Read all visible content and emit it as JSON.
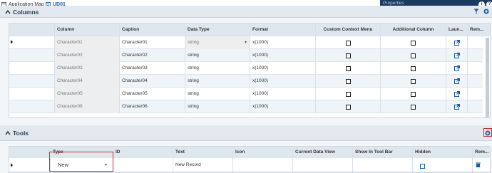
{
  "tabs": [
    {
      "label": "Application Map",
      "active": false
    },
    {
      "label": "UD01",
      "active": true
    }
  ],
  "properties_label": "Properties",
  "columns_section": {
    "title": "Columns",
    "headers": [
      "Column",
      "Caption",
      "Data Type",
      "Format",
      "Custom Context Menu",
      "Additional Column",
      "Laun...",
      "Rem..."
    ],
    "rows": [
      {
        "column": "Character01",
        "caption": "Character01",
        "data_type": "string",
        "format": "x(1000)",
        "custom_context_menu": false,
        "additional_column": false
      },
      {
        "column": "Character02",
        "caption": "Character02",
        "data_type": "string",
        "format": "x(1000)",
        "custom_context_menu": false,
        "additional_column": false
      },
      {
        "column": "Character03",
        "caption": "Character03",
        "data_type": "string",
        "format": "x(1000)",
        "custom_context_menu": false,
        "additional_column": false
      },
      {
        "column": "Character04",
        "caption": "Character04",
        "data_type": "string",
        "format": "x(1000)",
        "custom_context_menu": false,
        "additional_column": false
      },
      {
        "column": "Character05",
        "caption": "Character05",
        "data_type": "string",
        "format": "x(1000)",
        "custom_context_menu": false,
        "additional_column": false
      },
      {
        "column": "Character06",
        "caption": "Character06",
        "data_type": "string",
        "format": "x(1000)",
        "custom_context_menu": false,
        "additional_column": false
      }
    ]
  },
  "tools_section": {
    "title": "Tools",
    "headers": [
      "Type",
      "ID",
      "Text",
      "Icon",
      "Current Data View",
      "Show In Tool Bar",
      "Hidden",
      "Rem..."
    ],
    "row": {
      "type": "New",
      "id": "",
      "text": "New Record",
      "icon": "",
      "current_data_view": "",
      "show_in_tool_bar": "",
      "hidden": false
    }
  },
  "colors": {
    "accent": "#1d5d9b",
    "highlight": "#d12b2b",
    "header_bg": "#dfe7ee",
    "dark_bar": "#1c3a5e"
  }
}
